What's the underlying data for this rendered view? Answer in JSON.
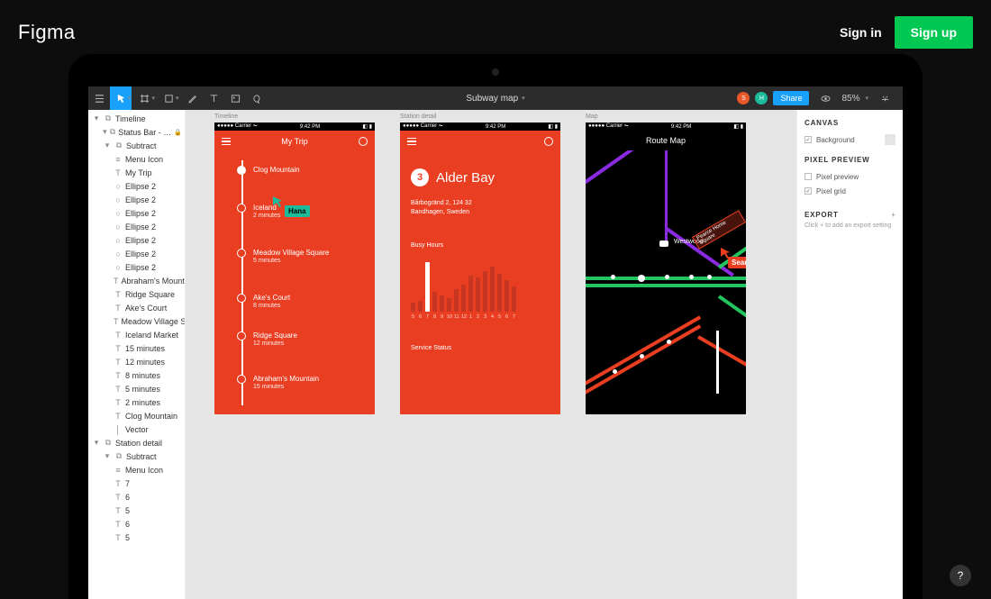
{
  "site": {
    "logo": "Figma",
    "signin": "Sign in",
    "signup": "Sign up"
  },
  "toolbar": {
    "doc_title": "Subway map",
    "share": "Share",
    "zoom": "85%",
    "avatar1": "S",
    "avatar2": "H"
  },
  "layers": [
    {
      "icon": "chev",
      "indent": 0,
      "label": "Timeline"
    },
    {
      "icon": "chev",
      "indent": 1,
      "label": "Status Bar - …",
      "lock": true
    },
    {
      "icon": "chev",
      "indent": 1,
      "label": "Subtract"
    },
    {
      "icon": "menu",
      "indent": 2,
      "label": "Menu Icon"
    },
    {
      "icon": "T",
      "indent": 2,
      "label": "My Trip"
    },
    {
      "icon": "O",
      "indent": 2,
      "label": "Ellipse 2"
    },
    {
      "icon": "O",
      "indent": 2,
      "label": "Ellipse 2"
    },
    {
      "icon": "O",
      "indent": 2,
      "label": "Ellipse 2"
    },
    {
      "icon": "O",
      "indent": 2,
      "label": "Ellipse 2"
    },
    {
      "icon": "O",
      "indent": 2,
      "label": "Ellipse 2"
    },
    {
      "icon": "O",
      "indent": 2,
      "label": "Ellipse 2"
    },
    {
      "icon": "O",
      "indent": 2,
      "label": "Ellipse 2"
    },
    {
      "icon": "T",
      "indent": 2,
      "label": "Abraham's Mountain"
    },
    {
      "icon": "T",
      "indent": 2,
      "label": "Ridge Square"
    },
    {
      "icon": "T",
      "indent": 2,
      "label": "Ake's Court"
    },
    {
      "icon": "T",
      "indent": 2,
      "label": "Meadow Village Square"
    },
    {
      "icon": "T",
      "indent": 2,
      "label": "Iceland Market"
    },
    {
      "icon": "T",
      "indent": 2,
      "label": "15 minutes"
    },
    {
      "icon": "T",
      "indent": 2,
      "label": "12 minutes"
    },
    {
      "icon": "T",
      "indent": 2,
      "label": "8 minutes"
    },
    {
      "icon": "T",
      "indent": 2,
      "label": "5 minutes"
    },
    {
      "icon": "T",
      "indent": 2,
      "label": "2 minutes"
    },
    {
      "icon": "T",
      "indent": 2,
      "label": "Clog Mountain"
    },
    {
      "icon": "line",
      "indent": 2,
      "label": "Vector"
    },
    {
      "icon": "chev",
      "indent": 0,
      "label": "Station detail"
    },
    {
      "icon": "chev",
      "indent": 1,
      "label": "Subtract"
    },
    {
      "icon": "menu",
      "indent": 2,
      "label": "Menu Icon"
    },
    {
      "icon": "T",
      "indent": 2,
      "label": "7"
    },
    {
      "icon": "T",
      "indent": 2,
      "label": "6"
    },
    {
      "icon": "T",
      "indent": 2,
      "label": "5"
    },
    {
      "icon": "T",
      "indent": 2,
      "label": "6"
    },
    {
      "icon": "T",
      "indent": 2,
      "label": "5"
    }
  ],
  "artboards": {
    "timeline": {
      "label": "Timeline",
      "title": "My Trip",
      "carrier": "Carrier",
      "time": "9:42 PM",
      "stops": [
        {
          "name": "Clog Mountain",
          "sub": ""
        },
        {
          "name": "Iceland",
          "sub": "2 minutes"
        },
        {
          "name": "Meadow Village Square",
          "sub": "5 minutes"
        },
        {
          "name": "Ake's Court",
          "sub": "8 minutes"
        },
        {
          "name": "Ridge Square",
          "sub": "12 minutes"
        },
        {
          "name": "Abraham's Mountain",
          "sub": "15 minutes"
        }
      ],
      "cursor": "Hana"
    },
    "detail": {
      "label": "Station detail",
      "time": "9:42 PM",
      "carrier": "Carrier",
      "number": "3",
      "station": "Alder Bay",
      "address1": "Bårbogränd 2, 124 32",
      "address2": "Bandhagen, Sweden",
      "busy_label": "Busy Hours",
      "service_label": "Service Status"
    },
    "map": {
      "label": "Map",
      "title": "Route Map",
      "time": "9:42 PM",
      "carrier": "Carrier",
      "station_label": "Westwood",
      "annotation": "Pearce Home Square",
      "cursor": "Sean"
    }
  },
  "chart_data": {
    "type": "bar",
    "title": "Busy Hours",
    "xlabel": "",
    "ylabel": "",
    "categories": [
      "5",
      "6",
      "7",
      "8",
      "9",
      "10",
      "11",
      "12",
      "1",
      "2",
      "3",
      "4",
      "5",
      "6",
      "7"
    ],
    "values": [
      10,
      12,
      55,
      22,
      18,
      15,
      25,
      30,
      40,
      38,
      45,
      50,
      42,
      35,
      28
    ],
    "highlighted_index": 2
  },
  "props": {
    "canvas_h": "CANVAS",
    "background": "Background",
    "preview_h": "PIXEL PREVIEW",
    "pixel_preview": "Pixel preview",
    "pixel_grid": "Pixel grid",
    "export_h": "EXPORT",
    "export_hint": "Click + to add an export setting"
  },
  "help": "?"
}
